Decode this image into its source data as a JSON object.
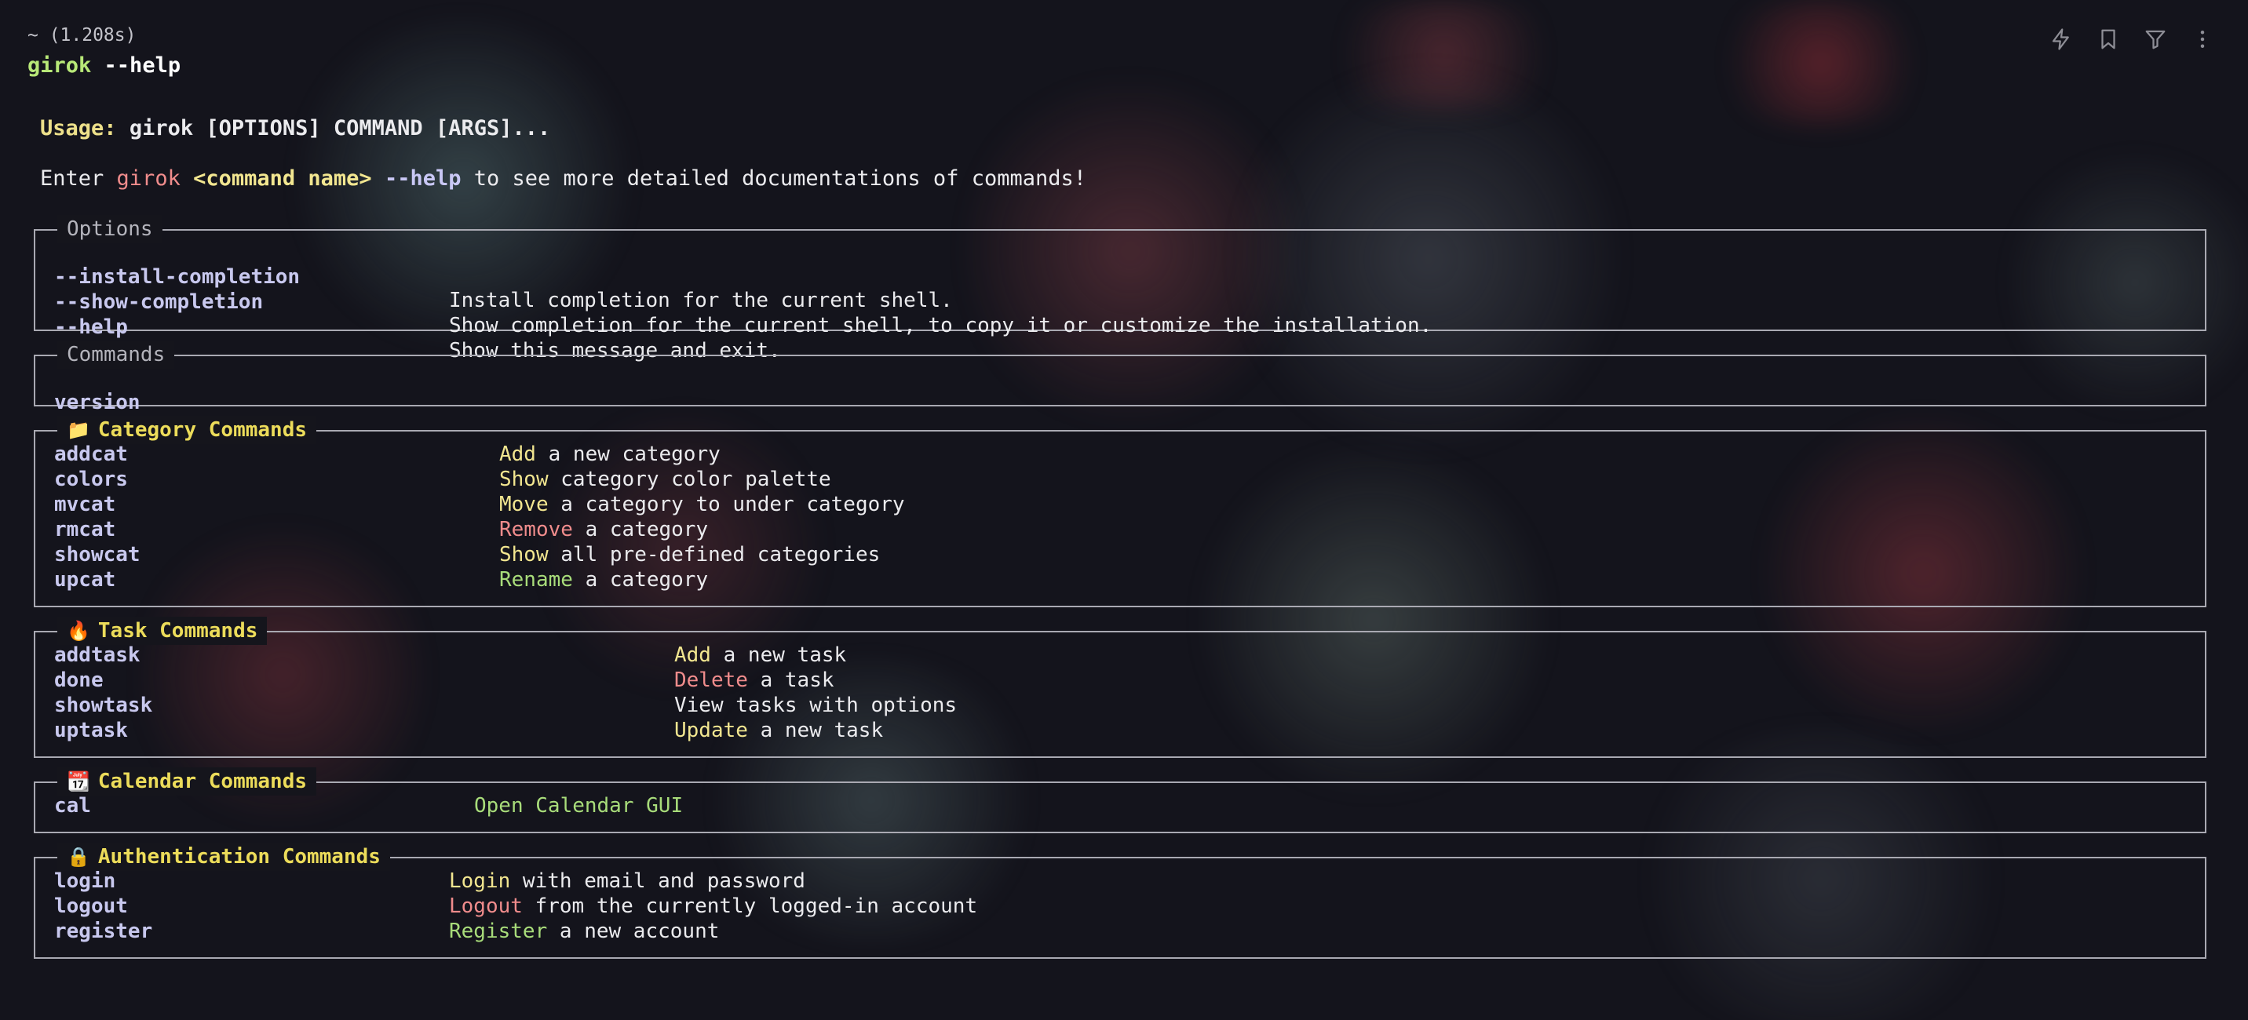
{
  "header": {
    "timing": "~ (1.208s)",
    "command": "girok",
    "argument": "--help"
  },
  "toolbar": {
    "icons": [
      "lightning-icon",
      "bookmark-icon",
      "filter-icon",
      "more-vertical-icon"
    ]
  },
  "usage": {
    "label": "Usage:",
    "text": "girok [OPTIONS] COMMAND [ARGS]..."
  },
  "enter_line": {
    "prefix": "Enter ",
    "app": "girok",
    "placeholder": "<command name>",
    "flag": "--help",
    "suffix": " to see more detailed documentations of commands!"
  },
  "options_panel": {
    "title": "Options",
    "rows": [
      {
        "key": "--install-completion",
        "desc": "Install completion for the current shell."
      },
      {
        "key": "--show-completion",
        "desc": "Show completion for the current shell, to copy it or customize the installation."
      },
      {
        "key": "--help",
        "desc": "Show this message and exit."
      }
    ]
  },
  "commands_panel": {
    "title": "Commands",
    "rows": [
      {
        "key": "version"
      }
    ]
  },
  "category_panel": {
    "emoji": "📁",
    "title": "Category Commands",
    "rows": [
      {
        "key": "addcat",
        "verb": "Add",
        "rest": " a new category"
      },
      {
        "key": "colors",
        "verb": "Show",
        "rest": " category color palette"
      },
      {
        "key": "mvcat",
        "verb": "Move",
        "rest": " a category to under category"
      },
      {
        "key": "rmcat",
        "verb": "Remove",
        "rest": " a category"
      },
      {
        "key": "showcat",
        "verb": "Show",
        "rest": " all pre-defined categories"
      },
      {
        "key": "upcat",
        "verb": "Rename",
        "rest": " a category"
      }
    ]
  },
  "task_panel": {
    "emoji": "🔥",
    "title": "Task Commands",
    "rows": [
      {
        "key": "addtask",
        "verb": "Add",
        "rest": " a new task"
      },
      {
        "key": "done",
        "verb": "Delete",
        "rest": " a task"
      },
      {
        "key": "showtask",
        "verb": "View",
        "rest": " tasks with options"
      },
      {
        "key": "uptask",
        "verb": "Update",
        "rest": " a new task"
      }
    ]
  },
  "calendar_panel": {
    "emoji": "📆",
    "title": "Calendar Commands",
    "rows": [
      {
        "key": "cal",
        "verb": "Open Calendar GUI"
      }
    ]
  },
  "auth_panel": {
    "emoji": "🔒",
    "title": "Authentication Commands",
    "rows": [
      {
        "key": "login",
        "verb": "Login",
        "rest": " with email and password"
      },
      {
        "key": "logout",
        "verb": "Logout",
        "rest": " from the currently logged-in account"
      },
      {
        "key": "register",
        "verb": "Register",
        "rest": " a new account"
      }
    ]
  },
  "colors": {
    "background": "#14141c",
    "command_name": "#b8e878",
    "panel_title": "#ecdc5a",
    "key": "#c8c8ee",
    "verb_yellow": "#f2e690",
    "verb_red": "#f08c8c",
    "verb_green": "#a8dc7a"
  }
}
